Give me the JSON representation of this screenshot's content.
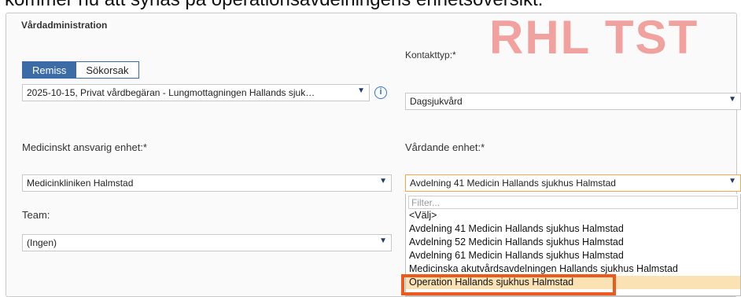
{
  "caption": "kommer nu att synas på operationsavdelningens enhetsöversikt.",
  "panel": {
    "title": "Vårdadministration"
  },
  "watermark": "RHL TST",
  "mode": {
    "tabs": [
      "Remiss",
      "Sökorsak"
    ],
    "selected": "Remiss"
  },
  "referral": {
    "value": "2025-10-15, Privat vårdbegäran  - Lungmottagningen Hallands sjuk…"
  },
  "contact_type": {
    "label": "Kontakttyp:*",
    "value": "Dagsjukvård"
  },
  "medical_unit": {
    "label": "Medicinskt ansvarig enhet:*",
    "value": "Medicinkliniken Halmstad"
  },
  "care_unit": {
    "label": "Vårdande enhet:*",
    "value": "Avdelning 41 Medicin Hallands sjukhus Halmstad",
    "filter_placeholder": "Filter...",
    "options": [
      "<Välj>",
      "Avdelning 41 Medicin Hallands sjukhus Halmstad",
      "Avdelning 52 Medicin Hallands sjukhus Halmstad",
      "Avdelning 61 Medicin Hallands sjukhus Halmstad",
      "Medicinska akutvårdsavdelningen Hallands sjukhus Halmstad",
      "Operation Hallands sjukhus Halmstad"
    ],
    "highlighted_option": "Operation Hallands sjukhus Halmstad"
  },
  "team": {
    "label": "Team:",
    "value": "(Ingen)"
  },
  "icons": {
    "info": "info-icon",
    "dropdown": "chevron-down-icon"
  }
}
